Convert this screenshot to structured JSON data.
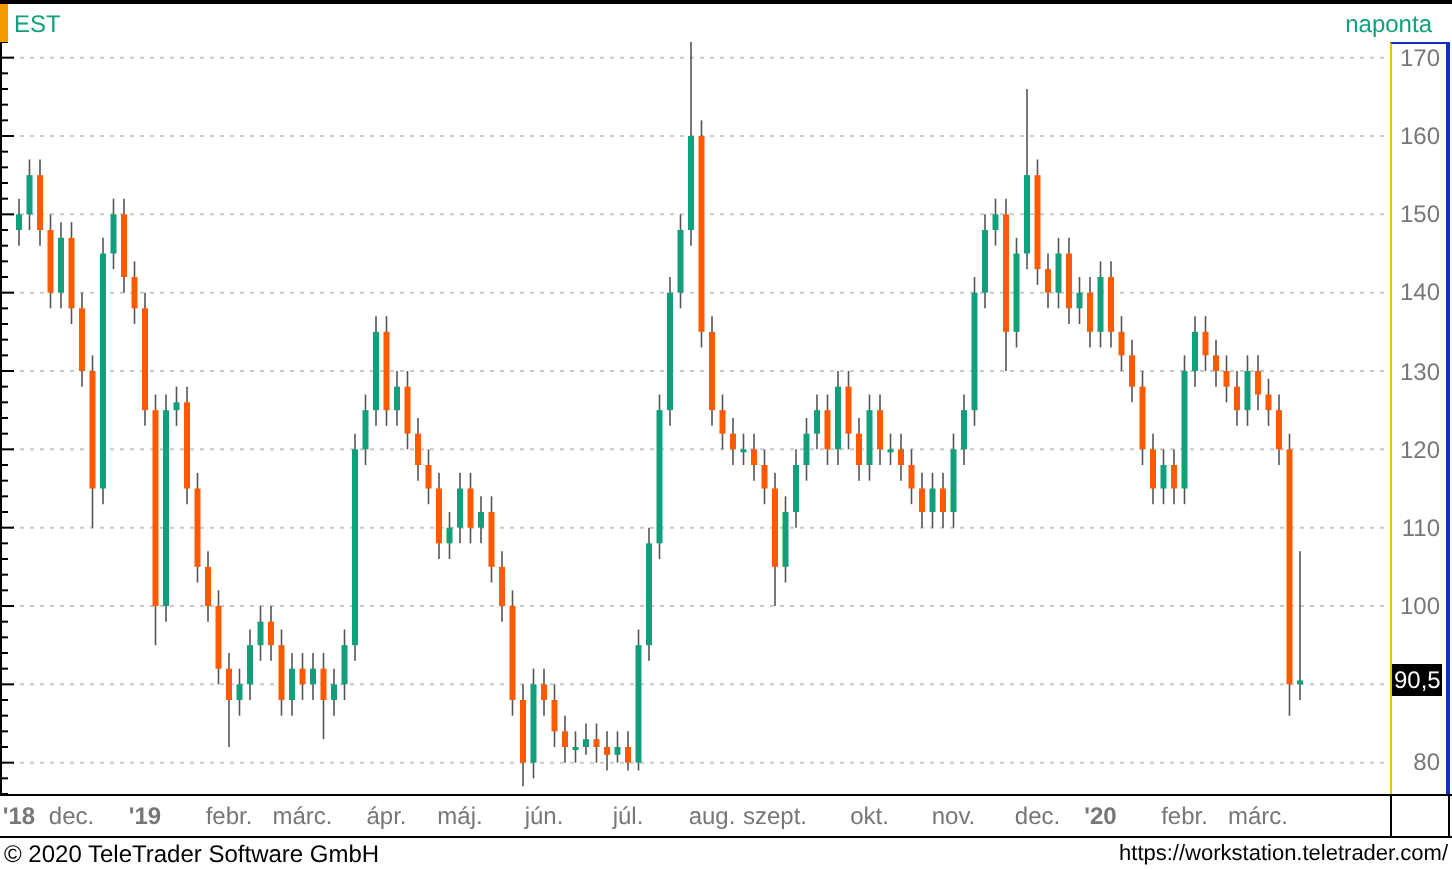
{
  "header": {
    "interval": "naponta"
  },
  "chart": {
    "chart_data": {
      "type": "candlestick",
      "grid": true,
      "ylim": [
        76,
        172
      ],
      "yticks": [
        80,
        100,
        110,
        120,
        130,
        140,
        150,
        160,
        170
      ],
      "categories": [
        "**'18**",
        null,
        null,
        null,
        null,
        "dec.",
        null,
        null,
        null,
        null,
        null,
        null,
        "**'19**",
        null,
        null,
        null,
        null,
        null,
        null,
        null,
        "febr.",
        null,
        null,
        null,
        null,
        null,
        null,
        "márc.",
        null,
        null,
        null,
        null,
        null,
        null,
        null,
        "ápr.",
        null,
        null,
        null,
        null,
        null,
        null,
        "máj.",
        null,
        null,
        null,
        null,
        null,
        null,
        null,
        "jún.",
        null,
        null,
        null,
        null,
        null,
        null,
        null,
        "júl.",
        null,
        null,
        null,
        null,
        null,
        null,
        null,
        "aug.",
        null,
        null,
        null,
        null,
        null,
        "szept.",
        null,
        null,
        null,
        null,
        null,
        null,
        null,
        null,
        "okt.",
        null,
        null,
        null,
        null,
        null,
        null,
        null,
        "nov.",
        null,
        null,
        null,
        null,
        null,
        null,
        null,
        "dec.",
        null,
        null,
        null,
        null,
        null,
        "**'20**",
        null,
        null,
        null,
        null,
        null,
        null,
        null,
        "febr.",
        null,
        null,
        null,
        null,
        null,
        null,
        "márc.",
        null,
        null,
        null,
        null
      ],
      "series": [
        {
          "name": "EST",
          "ohlc": [
            [
              148,
              152,
              146,
              150
            ],
            [
              150,
              157,
              148,
              155
            ],
            [
              155,
              157,
              146,
              148
            ],
            [
              148,
              150,
              138,
              140
            ],
            [
              140,
              149,
              138,
              147
            ],
            [
              147,
              149,
              136,
              138
            ],
            [
              138,
              140,
              128,
              130
            ],
            [
              130,
              132,
              110,
              115
            ],
            [
              115,
              147,
              113,
              145
            ],
            [
              145,
              152,
              143,
              150
            ],
            [
              150,
              152,
              140,
              142
            ],
            [
              142,
              144,
              136,
              138
            ],
            [
              138,
              140,
              123,
              125
            ],
            [
              125,
              127,
              95,
              100
            ],
            [
              100,
              127,
              98,
              125
            ],
            [
              125,
              128,
              123,
              126
            ],
            [
              126,
              128,
              113,
              115
            ],
            [
              115,
              117,
              103,
              105
            ],
            [
              105,
              107,
              98,
              100
            ],
            [
              100,
              102,
              90,
              92
            ],
            [
              92,
              94,
              82,
              88
            ],
            [
              88,
              92,
              86,
              90
            ],
            [
              90,
              97,
              88,
              95
            ],
            [
              95,
              100,
              93,
              98
            ],
            [
              98,
              100,
              93,
              95
            ],
            [
              95,
              97,
              86,
              88
            ],
            [
              88,
              94,
              86,
              92
            ],
            [
              92,
              94,
              88,
              90
            ],
            [
              90,
              94,
              88,
              92
            ],
            [
              92,
              94,
              83,
              88
            ],
            [
              88,
              92,
              86,
              90
            ],
            [
              90,
              97,
              88,
              95
            ],
            [
              95,
              122,
              93,
              120
            ],
            [
              120,
              127,
              118,
              125
            ],
            [
              125,
              137,
              123,
              135
            ],
            [
              135,
              137,
              123,
              125
            ],
            [
              125,
              130,
              123,
              128
            ],
            [
              128,
              130,
              120,
              122
            ],
            [
              122,
              124,
              116,
              118
            ],
            [
              118,
              120,
              113,
              115
            ],
            [
              115,
              117,
              106,
              108
            ],
            [
              108,
              112,
              106,
              110
            ],
            [
              110,
              117,
              108,
              115
            ],
            [
              115,
              117,
              108,
              110
            ],
            [
              110,
              114,
              108,
              112
            ],
            [
              112,
              114,
              103,
              105
            ],
            [
              105,
              107,
              98,
              100
            ],
            [
              100,
              102,
              86,
              88
            ],
            [
              88,
              90,
              77,
              80
            ],
            [
              80,
              92,
              78,
              90
            ],
            [
              90,
              92,
              86,
              88
            ],
            [
              88,
              90,
              82,
              84
            ],
            [
              84,
              86,
              80,
              82
            ],
            [
              82,
              84,
              80,
              82
            ],
            [
              82,
              85,
              81,
              83
            ],
            [
              83,
              85,
              80,
              82
            ],
            [
              82,
              84,
              79,
              81
            ],
            [
              81,
              84,
              80,
              82
            ],
            [
              82,
              84,
              79,
              80
            ],
            [
              80,
              97,
              79,
              95
            ],
            [
              95,
              110,
              93,
              108
            ],
            [
              108,
              127,
              106,
              125
            ],
            [
              125,
              142,
              123,
              140
            ],
            [
              140,
              150,
              138,
              148
            ],
            [
              148,
              172,
              146,
              160
            ],
            [
              160,
              162,
              133,
              135
            ],
            [
              135,
              137,
              123,
              125
            ],
            [
              125,
              127,
              120,
              122
            ],
            [
              122,
              124,
              118,
              120
            ],
            [
              120,
              122,
              118,
              120
            ],
            [
              120,
              122,
              116,
              118
            ],
            [
              118,
              120,
              113,
              115
            ],
            [
              115,
              117,
              100,
              105
            ],
            [
              105,
              114,
              103,
              112
            ],
            [
              112,
              120,
              110,
              118
            ],
            [
              118,
              124,
              116,
              122
            ],
            [
              122,
              127,
              120,
              125
            ],
            [
              125,
              127,
              118,
              120
            ],
            [
              120,
              130,
              118,
              128
            ],
            [
              128,
              130,
              120,
              122
            ],
            [
              122,
              124,
              116,
              118
            ],
            [
              118,
              127,
              116,
              125
            ],
            [
              125,
              127,
              118,
              120
            ],
            [
              120,
              122,
              118,
              120
            ],
            [
              120,
              122,
              116,
              118
            ],
            [
              118,
              120,
              113,
              115
            ],
            [
              115,
              117,
              110,
              112
            ],
            [
              112,
              117,
              110,
              115
            ],
            [
              115,
              117,
              110,
              112
            ],
            [
              112,
              122,
              110,
              120
            ],
            [
              120,
              127,
              118,
              125
            ],
            [
              125,
              142,
              123,
              140
            ],
            [
              140,
              150,
              138,
              148
            ],
            [
              148,
              152,
              146,
              150
            ],
            [
              150,
              152,
              130,
              135
            ],
            [
              135,
              147,
              133,
              145
            ],
            [
              145,
              166,
              143,
              155
            ],
            [
              155,
              157,
              141,
              143
            ],
            [
              143,
              145,
              138,
              140
            ],
            [
              140,
              147,
              138,
              145
            ],
            [
              145,
              147,
              136,
              138
            ],
            [
              138,
              142,
              136,
              140
            ],
            [
              140,
              142,
              133,
              135
            ],
            [
              135,
              144,
              133,
              142
            ],
            [
              142,
              144,
              133,
              135
            ],
            [
              135,
              137,
              130,
              132
            ],
            [
              132,
              134,
              126,
              128
            ],
            [
              128,
              130,
              118,
              120
            ],
            [
              120,
              122,
              113,
              115
            ],
            [
              115,
              120,
              113,
              118
            ],
            [
              118,
              120,
              113,
              115
            ],
            [
              115,
              132,
              113,
              130
            ],
            [
              130,
              137,
              128,
              135
            ],
            [
              135,
              137,
              130,
              132
            ],
            [
              132,
              134,
              128,
              130
            ],
            [
              130,
              132,
              126,
              128
            ],
            [
              128,
              130,
              123,
              125
            ],
            [
              125,
              132,
              123,
              130
            ],
            [
              130,
              132,
              125,
              127
            ],
            [
              127,
              129,
              123,
              125
            ],
            [
              125,
              127,
              118,
              120
            ],
            [
              120,
              122,
              86,
              90
            ],
            [
              90,
              107,
              88,
              90.5
            ]
          ]
        }
      ]
    },
    "last_price": "90,5"
  },
  "footer": {
    "copyright": "© 2020 TeleTrader Software GmbH",
    "url": "https://workstation.teletrader.com/"
  }
}
